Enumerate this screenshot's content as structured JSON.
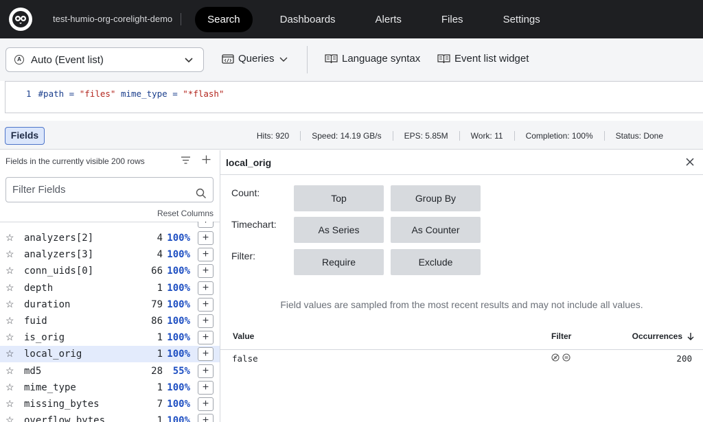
{
  "topnav": {
    "org": "test-humio-org-corelight-demo",
    "tabs": [
      "Search",
      "Dashboards",
      "Alerts",
      "Files",
      "Settings"
    ],
    "active_tab": "Search"
  },
  "toolbar": {
    "mode_label": "Auto (Event list)",
    "mode_icon_letter": "A",
    "queries_label": "Queries",
    "language_syntax_label": "Language syntax",
    "event_list_widget_label": "Event list widget"
  },
  "editor": {
    "line_number": "1",
    "query_part1": "#path = ",
    "query_str1": "\"files\"",
    "query_part2": " mime_type = ",
    "query_str2": "\"*flash\""
  },
  "status": {
    "fields_button": "Fields",
    "hits": "Hits: 920",
    "speed": "Speed: 14.19 GB/s",
    "eps": "EPS: 5.85M",
    "work": "Work: 11",
    "completion": "Completion: 100%",
    "state": "Status: Done"
  },
  "fields_panel": {
    "heading": "Fields in the currently visible 200 rows",
    "filter_placeholder": "Filter Fields",
    "reset_columns": "Reset Columns",
    "rows": [
      {
        "name": "analyzers[2]",
        "count": "4",
        "pct": "100%"
      },
      {
        "name": "analyzers[3]",
        "count": "4",
        "pct": "100%"
      },
      {
        "name": "conn_uids[0]",
        "count": "66",
        "pct": "100%"
      },
      {
        "name": "depth",
        "count": "1",
        "pct": "100%"
      },
      {
        "name": "duration",
        "count": "79",
        "pct": "100%"
      },
      {
        "name": "fuid",
        "count": "86",
        "pct": "100%"
      },
      {
        "name": "is_orig",
        "count": "1",
        "pct": "100%"
      },
      {
        "name": "local_orig",
        "count": "1",
        "pct": "100%",
        "selected": true
      },
      {
        "name": "md5",
        "count": "28",
        "pct": "55%"
      },
      {
        "name": "mime_type",
        "count": "1",
        "pct": "100%"
      },
      {
        "name": "missing_bytes",
        "count": "7",
        "pct": "100%"
      },
      {
        "name": "overflow_bytes",
        "count": "1",
        "pct": "100%"
      }
    ]
  },
  "details": {
    "title": "local_orig",
    "count_label": "Count:",
    "timechart_label": "Timechart:",
    "filter_label": "Filter:",
    "btn_top": "Top",
    "btn_group_by": "Group By",
    "btn_as_series": "As Series",
    "btn_as_counter": "As Counter",
    "btn_require": "Require",
    "btn_exclude": "Exclude",
    "note": "Field values are sampled from the most recent results and may not include all values.",
    "col_value": "Value",
    "col_filter": "Filter",
    "col_occurrences": "Occurrences",
    "value": "false",
    "occurrences": "200"
  },
  "colors": {
    "nav_bg": "#1e1f22",
    "accent_blue": "#1e4fc2",
    "selected_row": "#e3ebfc",
    "button_gray": "#d7dade"
  }
}
